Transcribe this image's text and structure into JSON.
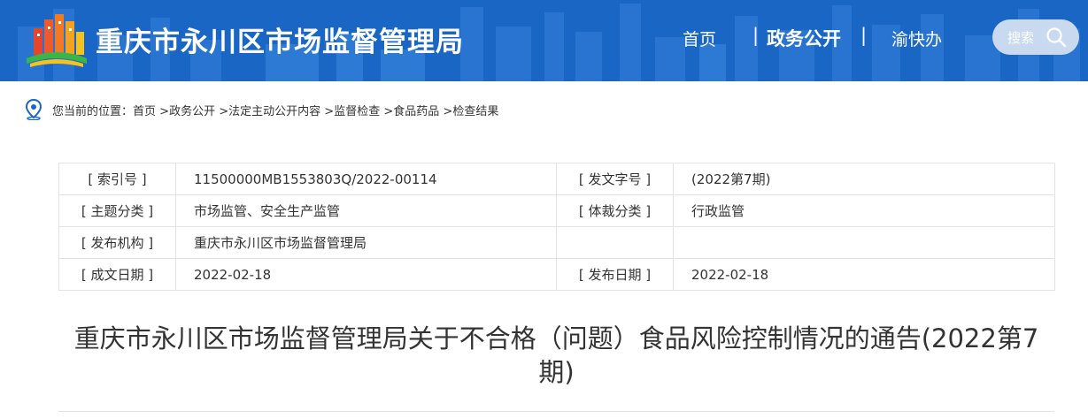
{
  "header": {
    "site_title": "重庆市永川区市场监督管理局",
    "nav": [
      {
        "label": "首页"
      },
      {
        "label": "政务公开",
        "active": true
      },
      {
        "label": "渝快办"
      }
    ],
    "separator": "|",
    "search_label": "搜索",
    "bg_color": "#1a66c4"
  },
  "breadcrumb": {
    "prefix": "您当前的位置：",
    "items": [
      "首页",
      "政务公开",
      "法定主动公开内容",
      "监督检查",
      "食品药品",
      "检查结果"
    ],
    "arrow": ">"
  },
  "info_table": {
    "rows": [
      {
        "label1": "[ 索引号 ]",
        "value1": "11500000MB1553803Q/2022-00114",
        "label2": "[ 发文字号 ]",
        "value2": "(2022第7期)"
      },
      {
        "label1": "[ 主题分类 ]",
        "value1": "市场监管、安全生产监管",
        "label2": "[ 体裁分类 ]",
        "value2": "行政监管"
      },
      {
        "label1": "[ 发布机构 ]",
        "value1": "重庆市永川区市场监督管理局",
        "label2": "",
        "value2": ""
      },
      {
        "label1": "[ 成文日期 ]",
        "value1": "2022-02-18",
        "label2": "[ 发布日期 ]",
        "value2": "2022-02-18"
      }
    ]
  },
  "document": {
    "title_line1": "重庆市永川区市场监督管理局关于不合格（问题）食品风险控制情况的通告(2022第7",
    "title_line2": "期)"
  }
}
